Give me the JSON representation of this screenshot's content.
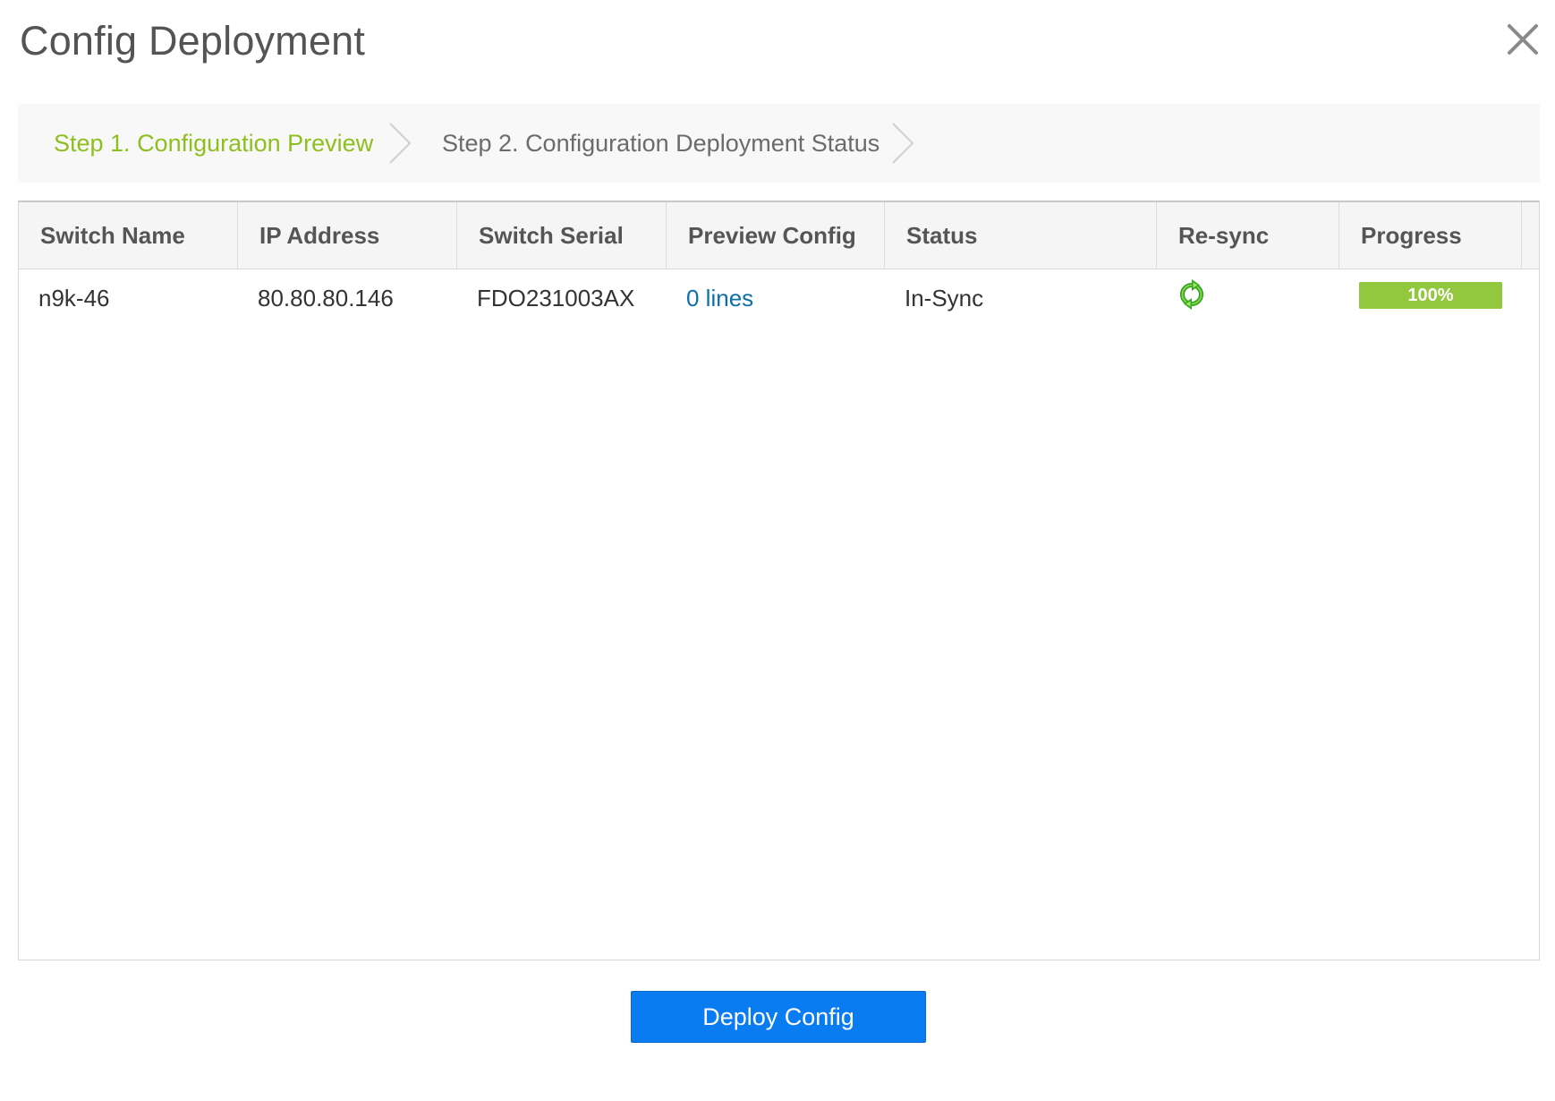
{
  "dialog": {
    "title": "Config Deployment"
  },
  "steps": [
    {
      "label": "Step 1. Configuration Preview",
      "active": true
    },
    {
      "label": "Step 2. Configuration Deployment Status",
      "active": false
    }
  ],
  "table": {
    "columns": [
      "Switch Name",
      "IP Address",
      "Switch Serial",
      "Preview Config",
      "Status",
      "Re-sync",
      "Progress"
    ],
    "rows": [
      {
        "switch_name": "n9k-46",
        "ip_address": "80.80.80.146",
        "switch_serial": "FDO231003AX",
        "preview_config": "0 lines",
        "status": "In-Sync",
        "resync_icon": "resync-arrows-icon",
        "progress_label": "100%",
        "progress_value": 100
      }
    ]
  },
  "footer": {
    "deploy_label": "Deploy Config"
  },
  "colors": {
    "step_active": "#8fbf1e",
    "link": "#0d6fa8",
    "progress_fill": "#92c83e",
    "primary_button": "#0a7cf2"
  }
}
